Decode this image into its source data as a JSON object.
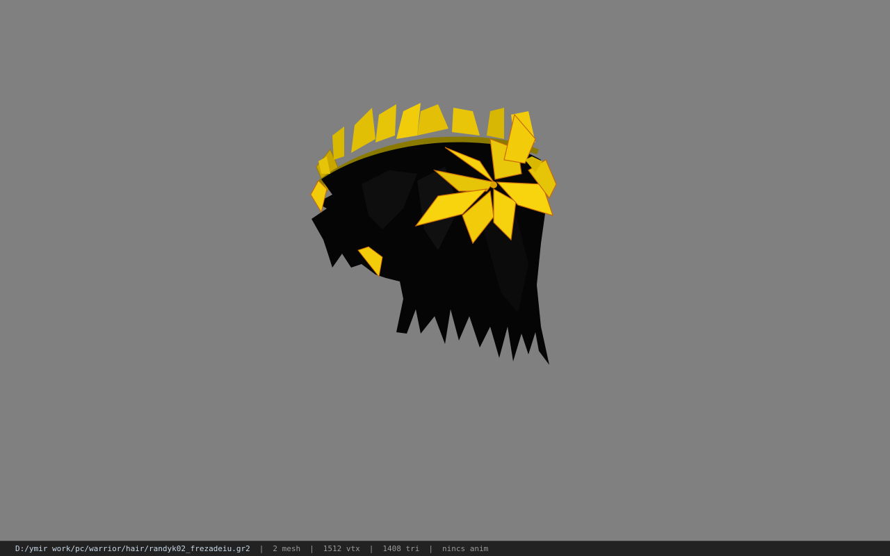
{
  "viewport": {
    "background": "#808080",
    "model_description_icon": "hair-model-with-golden-laurel-wreath"
  },
  "status_bar": {
    "file_path": "D:/ymir work/pc/warrior/hair/randyk02_frezadeiu.gr2",
    "separator": "|",
    "mesh_count": "2 mesh",
    "vertex_count": "1512 vtx",
    "triangle_count": "1408 tri",
    "anim_status": "nincs anim"
  },
  "colors": {
    "hair": "#050505",
    "leaf": "#f2cc0b",
    "leaf_shade": "#c9a700",
    "leaf_edge": "#c86a0a",
    "status_bg": "#222222",
    "status_path": "#c9d8e6",
    "status_text": "#9a9a9a"
  }
}
